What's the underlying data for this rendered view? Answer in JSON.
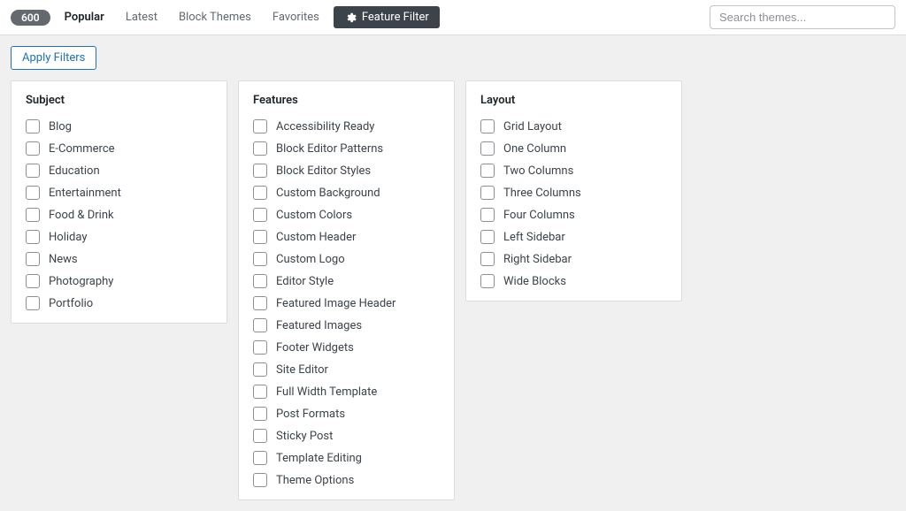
{
  "topbar": {
    "count": "600",
    "nav": [
      {
        "label": "Popular",
        "active": true
      },
      {
        "label": "Latest",
        "active": false
      },
      {
        "label": "Block Themes",
        "active": false
      },
      {
        "label": "Favorites",
        "active": false
      }
    ],
    "feature_filter_label": "Feature Filter",
    "search_placeholder": "Search themes..."
  },
  "apply_filters_label": "Apply Filters",
  "columns": [
    {
      "heading": "Subject",
      "options": [
        "Blog",
        "E-Commerce",
        "Education",
        "Entertainment",
        "Food & Drink",
        "Holiday",
        "News",
        "Photography",
        "Portfolio"
      ]
    },
    {
      "heading": "Features",
      "options": [
        "Accessibility Ready",
        "Block Editor Patterns",
        "Block Editor Styles",
        "Custom Background",
        "Custom Colors",
        "Custom Header",
        "Custom Logo",
        "Editor Style",
        "Featured Image Header",
        "Featured Images",
        "Footer Widgets",
        "Site Editor",
        "Full Width Template",
        "Post Formats",
        "Sticky Post",
        "Template Editing",
        "Theme Options"
      ]
    },
    {
      "heading": "Layout",
      "options": [
        "Grid Layout",
        "One Column",
        "Two Columns",
        "Three Columns",
        "Four Columns",
        "Left Sidebar",
        "Right Sidebar",
        "Wide Blocks"
      ]
    }
  ]
}
